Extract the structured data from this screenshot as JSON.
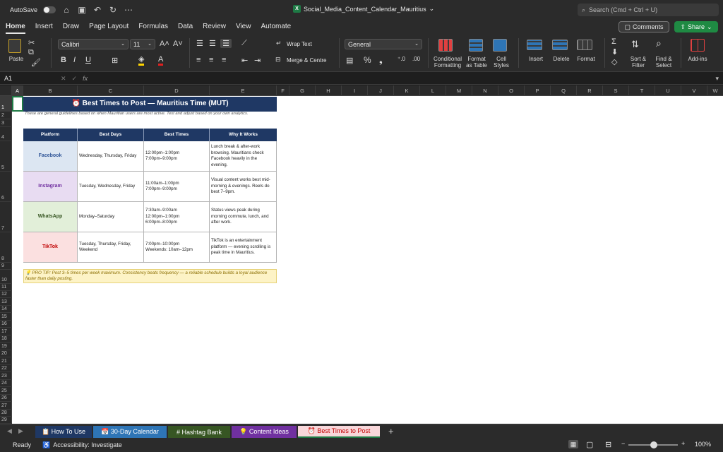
{
  "titlebar": {
    "autosave_label": "AutoSave",
    "doc_title": "Social_Media_Content_Calendar_Mauritius",
    "search_placeholder": "Search (Cmd + Ctrl + U)"
  },
  "menu": {
    "tabs": [
      "Home",
      "Insert",
      "Draw",
      "Page Layout",
      "Formulas",
      "Data",
      "Review",
      "View",
      "Automate"
    ],
    "active": "Home",
    "comments_label": "Comments",
    "share_label": "Share"
  },
  "ribbon": {
    "paste_label": "Paste",
    "font_name": "Calibri",
    "font_size": "11",
    "wrap_text": "Wrap Text",
    "merge_centre": "Merge & Centre",
    "number_format": "General",
    "conditional_formatting": "Conditional Formatting",
    "format_as_table": "Format as Table",
    "cell_styles": "Cell Styles",
    "insert": "Insert",
    "delete": "Delete",
    "format": "Format",
    "sort_filter": "Sort & Filter",
    "find_select": "Find & Select",
    "add_ins": "Add-ins"
  },
  "formula_bar": {
    "name_box": "A1",
    "fx_label": "fx"
  },
  "columns": [
    "A",
    "B",
    "C",
    "D",
    "E",
    "F",
    "G",
    "H",
    "I",
    "J",
    "K",
    "L",
    "M",
    "N",
    "O",
    "P",
    "Q",
    "R",
    "S",
    "T",
    "U",
    "V",
    "W"
  ],
  "rows": [
    "1",
    "2",
    "3",
    "4",
    "5",
    "6",
    "7",
    "8",
    "9",
    "10",
    "11",
    "12",
    "13",
    "14",
    "15",
    "16",
    "17",
    "18",
    "19",
    "20",
    "21",
    "22",
    "23",
    "24",
    "25",
    "26",
    "27",
    "28",
    "29"
  ],
  "sheet": {
    "title": "⏰ Best Times to Post — Mauritius Time (MUT)",
    "subtitle": "These are general guidelines based on when Mauritian users are most active. Test and adjust based on your own analytics.",
    "headers": [
      "Platform",
      "Best Days",
      "Best Times",
      "Why It Works"
    ],
    "rows": [
      {
        "platform": "Facebook",
        "days": "Wednesday, Thursday, Friday",
        "times": [
          "12:00pm–1:00pm",
          "7:00pm–9:00pm"
        ],
        "why": "Lunch break & after-work browsing. Mauritians check Facebook heavily in the evening.",
        "bg": "#dce6f2",
        "color": "#2f5597"
      },
      {
        "platform": "Instagram",
        "days": "Tuesday, Wednesday, Friday",
        "times": [
          "11:00am–1:00pm",
          "7:00pm–9:00pm"
        ],
        "why": "Visual content works best mid-morning & evenings. Reels do best 7–9pm.",
        "bg": "#e8dcf2",
        "color": "#7030a0"
      },
      {
        "platform": "WhatsApp",
        "days": "Monday–Saturday",
        "times": [
          "7:30am–9:00am",
          "12:00pm–1:00pm",
          "6:00pm–8:00pm"
        ],
        "why": "Status views peak during morning commute, lunch, and after work.",
        "bg": "#e2efd9",
        "color": "#375623"
      },
      {
        "platform": "TikTok",
        "days": "Tuesday, Thursday, Friday, Weekend",
        "times": [
          "7:00pm–10:00pm",
          "Weekends: 10am–12pm"
        ],
        "why": "TikTok is an entertainment platform — evening scrolling is peak time in Mauritius.",
        "bg": "#fbe0e0",
        "color": "#c00000"
      }
    ],
    "pro_tip": "💡 PRO TIP: Post 3–5 times per week maximum. Consistency beats frequency — a reliable schedule builds a loyal audience faster than daily posting."
  },
  "sheet_tabs": [
    {
      "label": "📋 How To Use",
      "color": "#1f3864"
    },
    {
      "label": "📅 30-Day Calendar",
      "color": "#2e75b6"
    },
    {
      "label": "# Hashtag Bank",
      "color": "#375623"
    },
    {
      "label": "💡 Content Ideas",
      "color": "#7030a0"
    },
    {
      "label": "⏰ Best Times to Post",
      "color": "#f8d7da",
      "active": true
    }
  ],
  "status": {
    "ready": "Ready",
    "accessibility": "Accessibility: Investigate",
    "zoom": "100%"
  }
}
